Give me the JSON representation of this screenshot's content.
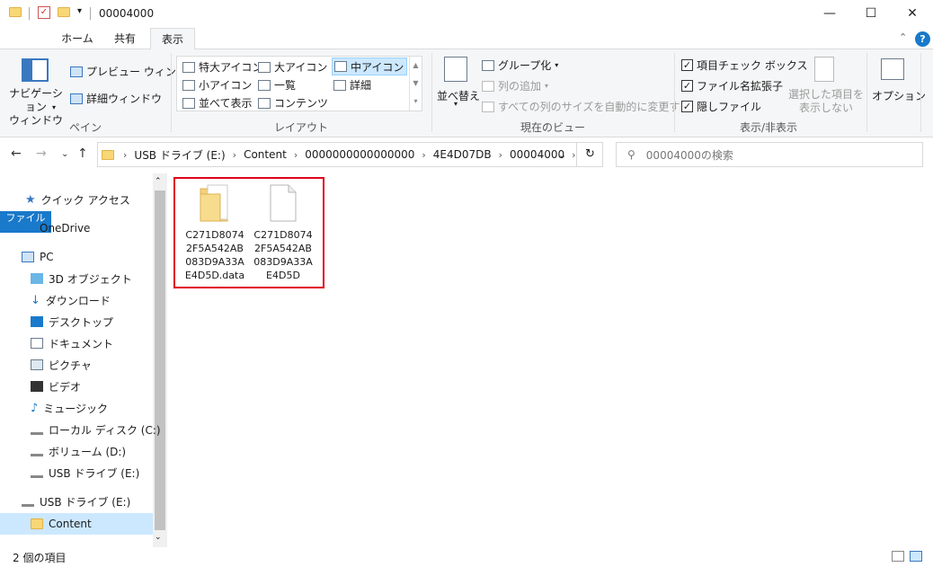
{
  "titlebar": {
    "title": "00004000",
    "minimize": "—",
    "maximize": "☐",
    "close": "✕"
  },
  "tabs": {
    "file": "ファイル",
    "home": "ホーム",
    "share": "共有",
    "view": "表示"
  },
  "ribbon": {
    "pane": {
      "nav_pane": "ナビゲーション\nウィンドウ",
      "preview": "プレビュー ウィンドウ",
      "details": "詳細ウィンドウ",
      "label": "ペイン"
    },
    "layout": {
      "xlarge": "特大アイコン",
      "large": "大アイコン",
      "medium": "中アイコン",
      "small": "小アイコン",
      "list": "一覧",
      "details": "詳細",
      "tiles": "並べて表示",
      "content": "コンテンツ",
      "label": "レイアウト"
    },
    "current_view": {
      "sort": "並べ替え",
      "group": "グループ化",
      "add_column": "列の追加",
      "autosize": "すべての列のサイズを自動的に変更する",
      "label": "現在のビュー"
    },
    "show_hide": {
      "item_checkbox": "項目チェック ボックス",
      "extensions": "ファイル名拡張子",
      "hidden": "隠しファイル",
      "hide_selected": "選択した項目を\n表示しない",
      "label": "表示/非表示"
    },
    "options": "オプション"
  },
  "address": {
    "crumbs": [
      "USB ドライブ (E:)",
      "Content",
      "0000000000000000",
      "4E4D07DB",
      "00004000"
    ],
    "search_placeholder": "00004000の検索"
  },
  "navpane": {
    "quick_access": "クイック アクセス",
    "onedrive": "OneDrive",
    "pc": "PC",
    "objects3d": "3D オブジェクト",
    "downloads": "ダウンロード",
    "desktop": "デスクトップ",
    "documents": "ドキュメント",
    "pictures": "ピクチャ",
    "videos": "ビデオ",
    "music": "ミュージック",
    "local_disk": "ローカル ディスク (C:)",
    "volume_d": "ボリューム (D:)",
    "usb_e": "USB ドライブ (E:)",
    "usb_e2": "USB ドライブ (E:)",
    "content": "Content"
  },
  "files": [
    {
      "lines": [
        "C271D8074",
        "2F5A542AB",
        "083D9A33A",
        "E4D5D.data"
      ],
      "type": "folder"
    },
    {
      "lines": [
        "C271D8074",
        "2F5A542AB",
        "083D9A33A",
        "E4D5D"
      ],
      "type": "file"
    }
  ],
  "status": {
    "count": "2 個の項目"
  }
}
